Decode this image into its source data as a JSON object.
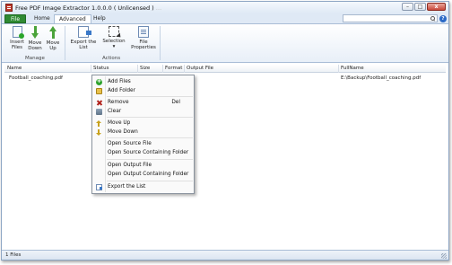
{
  "window": {
    "title": "Free PDF Image Extractor 1.0.0.0  ( Unlicensed )",
    "title_suffix": "…",
    "buttons": {
      "minimize": "–",
      "maximize": "□",
      "close": "x"
    }
  },
  "ribbon": {
    "tabs": {
      "file": "File",
      "home": "Home",
      "advanced": "Advanced",
      "help": "Help"
    },
    "active_tab": "Advanced",
    "help_glyph": "?",
    "groups": {
      "manage": {
        "label": "Manage",
        "buttons": {
          "insert": "Insert\nFiles",
          "move_down": "Move\nDown",
          "move_up": "Move\nUp"
        }
      },
      "actions": {
        "label": "Actions",
        "buttons": {
          "export": "Export the\nList",
          "selection": "Selection",
          "selection_caret": "▾",
          "properties": "File\nProperties"
        }
      }
    }
  },
  "list": {
    "columns": {
      "name": "Name",
      "status": "Status",
      "size": "Size",
      "format": "Format",
      "output_file": "Output File",
      "full_name": "FullName"
    },
    "rows": [
      {
        "name": "Football_coaching.pdf",
        "full_name": "E:\\Backup\\Football_coaching.pdf"
      }
    ]
  },
  "context_menu": {
    "add_files": "Add Files",
    "add_folder": "Add Folder",
    "remove": "Remove",
    "remove_shortcut": "Del",
    "clear": "Clear",
    "move_up": "Move Up",
    "move_down": "Move Down",
    "open_source_file": "Open Source File",
    "open_source_folder": "Open Source Containing Folder",
    "open_output_file": "Open Output File",
    "open_output_folder": "Open Output Containing Folder",
    "export_list": "Export the List"
  },
  "statusbar": {
    "text": "1 Files"
  },
  "colors": {
    "file_tab": "#2f8a32",
    "accent": "#2c6ac6",
    "icon_green": "#4aa33a"
  }
}
